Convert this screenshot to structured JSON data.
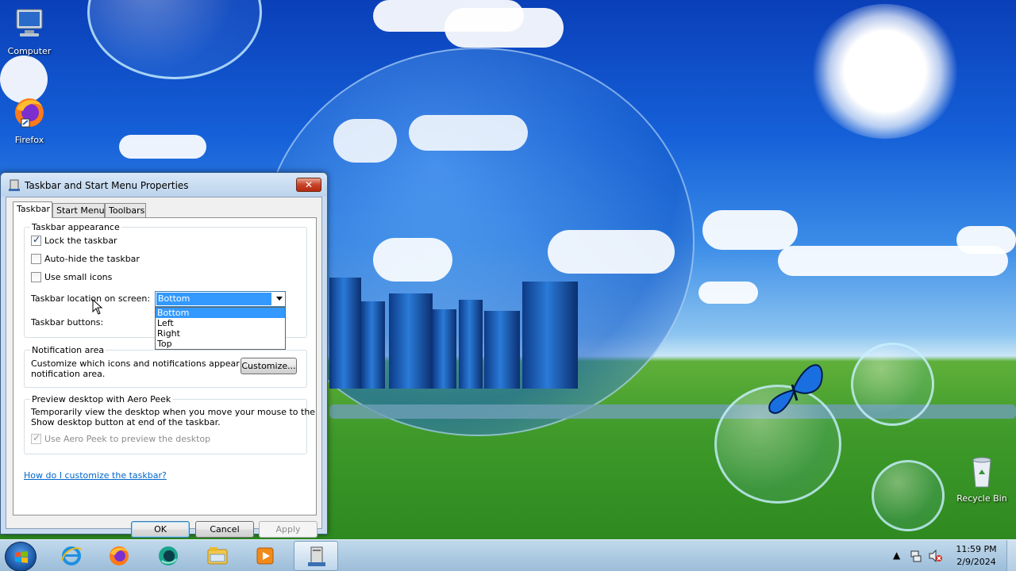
{
  "desktop": {
    "icons": [
      {
        "label": "Computer",
        "icon": "computer-icon"
      },
      {
        "label": "Firefox",
        "icon": "firefox-icon"
      },
      {
        "label": "Recycle Bin",
        "icon": "recycle-bin-icon"
      }
    ]
  },
  "window": {
    "title": "Taskbar and Start Menu Properties",
    "close_label": "✕",
    "tabs": [
      "Taskbar",
      "Start Menu",
      "Toolbars"
    ],
    "active_tab": "Taskbar",
    "appearance": {
      "title": "Taskbar appearance",
      "lock": {
        "label": "Lock the taskbar",
        "checked": true
      },
      "autohide": {
        "label": "Auto-hide the taskbar",
        "checked": false
      },
      "small_icons": {
        "label": "Use small icons",
        "checked": false
      },
      "location_label": "Taskbar location on screen:",
      "location_value": "Bottom",
      "location_options": [
        "Bottom",
        "Left",
        "Right",
        "Top"
      ],
      "buttons_label": "Taskbar buttons:"
    },
    "notification": {
      "title": "Notification area",
      "text_line1": "Customize which icons and notifications appear in the",
      "text_line2": "notification area.",
      "customize_label": "Customize..."
    },
    "aero_peek": {
      "title": "Preview desktop with Aero Peek",
      "text_line1": "Temporarily view the desktop when you move your mouse to the",
      "text_line2": "Show desktop button at end of the taskbar.",
      "checkbox_label": "Use Aero Peek to preview the desktop",
      "checked": true,
      "disabled": true
    },
    "help_link": "How do I customize the taskbar?",
    "buttons": {
      "ok": "OK",
      "cancel": "Cancel",
      "apply": "Apply"
    }
  },
  "taskbar": {
    "pinned": [
      "internet-explorer-icon",
      "firefox-icon",
      "app-icon",
      "file-explorer-icon",
      "media-player-icon",
      "taskbar-properties-icon"
    ],
    "active_item": "taskbar-properties-icon",
    "clock_time": "11:59 PM",
    "clock_date": "2/9/2024"
  },
  "colors": {
    "selection": "#3399ff",
    "link": "#0066cc",
    "close_button": "#c7432a"
  }
}
